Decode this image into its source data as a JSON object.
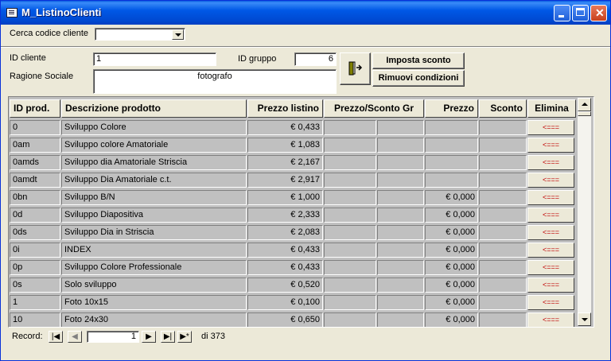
{
  "window": {
    "title": "M_ListinoClienti"
  },
  "search": {
    "label": "Cerca codice cliente",
    "value": ""
  },
  "customer": {
    "id_label": "ID cliente",
    "id_value": "1",
    "group_label": "ID gruppo",
    "group_value": "6",
    "name_label": "Ragione Sociale",
    "name_value": "fotografo"
  },
  "buttons": {
    "set_discount": "Imposta sconto",
    "remove_conditions": "Rimuovi condizioni"
  },
  "table": {
    "headers": [
      "ID prod.",
      "Descrizione prodotto",
      "Prezzo listino",
      "Prezzo/Sconto Gr",
      "Prezzo",
      "Sconto",
      "Elimina"
    ],
    "delete_label": "<===",
    "rows": [
      {
        "id": "0",
        "desc": "Sviluppo Colore",
        "list": "€ 0,433",
        "price": ""
      },
      {
        "id": "0am",
        "desc": "Sviluppo colore Amatoriale",
        "list": "€ 1,083",
        "price": ""
      },
      {
        "id": "0amds",
        "desc": "Sviluppo dia Amatoriale Striscia",
        "list": "€ 2,167",
        "price": ""
      },
      {
        "id": "0amdt",
        "desc": "Sviluppo Dia Amatoriale c.t.",
        "list": "€ 2,917",
        "price": ""
      },
      {
        "id": "0bn",
        "desc": "Sviluppo B/N",
        "list": "€ 1,000",
        "price": "€ 0,000"
      },
      {
        "id": "0d",
        "desc": "Sviluppo Diapositiva",
        "list": "€ 2,333",
        "price": "€ 0,000"
      },
      {
        "id": "0ds",
        "desc": "Sviluppo Dia in Striscia",
        "list": "€ 2,083",
        "price": "€ 0,000"
      },
      {
        "id": "0i",
        "desc": "INDEX",
        "list": "€ 0,433",
        "price": "€ 0,000"
      },
      {
        "id": "0p",
        "desc": "Sviluppo Colore Professionale",
        "list": "€ 0,433",
        "price": "€ 0,000"
      },
      {
        "id": "0s",
        "desc": "Solo sviluppo",
        "list": "€ 0,520",
        "price": "€ 0,000"
      },
      {
        "id": "1",
        "desc": "Foto 10x15",
        "list": "€ 0,100",
        "price": "€ 0,000"
      },
      {
        "id": "10",
        "desc": "Foto 24x30",
        "list": "€ 0,650",
        "price": "€ 0,000"
      }
    ]
  },
  "record_nav": {
    "label": "Record:",
    "current": "1",
    "total": "di 373"
  }
}
